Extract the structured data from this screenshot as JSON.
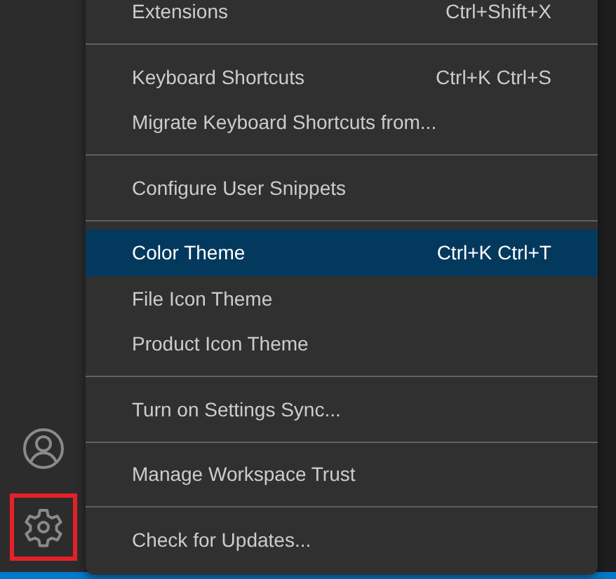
{
  "activity_bar": {
    "items": [
      {
        "kind": "account",
        "highlighted": false
      },
      {
        "kind": "settings",
        "highlighted": true
      }
    ]
  },
  "menu": {
    "items": [
      {
        "kind": "item",
        "label": "Extensions",
        "shortcut": "Ctrl+Shift+X",
        "selected": false
      },
      {
        "kind": "separator"
      },
      {
        "kind": "item",
        "label": "Keyboard Shortcuts",
        "shortcut": "Ctrl+K Ctrl+S",
        "selected": false
      },
      {
        "kind": "item",
        "label": "Migrate Keyboard Shortcuts from...",
        "selected": false
      },
      {
        "kind": "separator"
      },
      {
        "kind": "item",
        "label": "Configure User Snippets",
        "selected": false
      },
      {
        "kind": "separator"
      },
      {
        "kind": "item",
        "label": "Color Theme",
        "shortcut": "Ctrl+K Ctrl+T",
        "selected": true
      },
      {
        "kind": "item",
        "label": "File Icon Theme",
        "selected": false
      },
      {
        "kind": "item",
        "label": "Product Icon Theme",
        "selected": false
      },
      {
        "kind": "separator"
      },
      {
        "kind": "item",
        "label": "Turn on Settings Sync...",
        "selected": false
      },
      {
        "kind": "separator"
      },
      {
        "kind": "item",
        "label": "Manage Workspace Trust",
        "selected": false
      },
      {
        "kind": "separator"
      },
      {
        "kind": "item",
        "label": "Check for Updates...",
        "selected": false
      }
    ]
  }
}
